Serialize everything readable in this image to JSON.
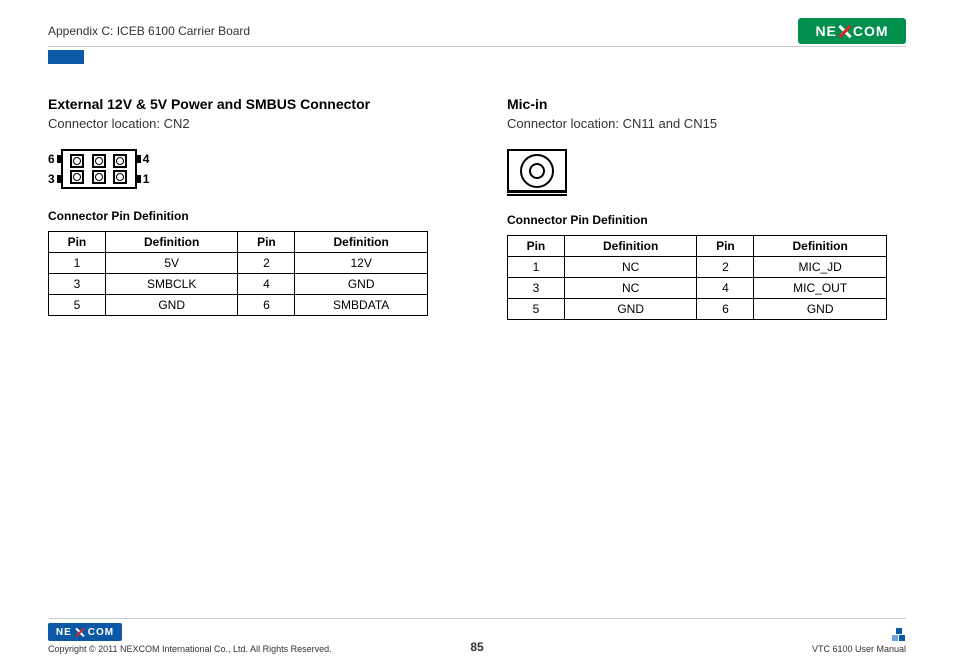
{
  "header": {
    "appendix": "Appendix C: ICEB 6100 Carrier Board",
    "brand": "NE COM"
  },
  "left": {
    "title": "External 12V & 5V Power and SMBUS Connector",
    "subtitle": "Connector location: CN2",
    "diagram_labels": {
      "tl": "6",
      "bl": "3",
      "tr": "4",
      "br": "1"
    },
    "table_title": "Connector Pin Definition",
    "headers": {
      "pin": "Pin",
      "def": "Definition"
    },
    "rows": [
      {
        "p1": "1",
        "d1": "5V",
        "p2": "2",
        "d2": "12V"
      },
      {
        "p1": "3",
        "d1": "SMBCLK",
        "p2": "4",
        "d2": "GND"
      },
      {
        "p1": "5",
        "d1": "GND",
        "p2": "6",
        "d2": "SMBDATA"
      }
    ]
  },
  "right": {
    "title": "Mic-in",
    "subtitle": "Connector location: CN11 and CN15",
    "table_title": "Connector Pin Definition",
    "headers": {
      "pin": "Pin",
      "def": "Definition"
    },
    "rows": [
      {
        "p1": "1",
        "d1": "NC",
        "p2": "2",
        "d2": "MIC_JD"
      },
      {
        "p1": "3",
        "d1": "NC",
        "p2": "4",
        "d2": "MIC_OUT"
      },
      {
        "p1": "5",
        "d1": "GND",
        "p2": "6",
        "d2": "GND"
      }
    ]
  },
  "footer": {
    "copyright": "Copyright © 2011 NEXCOM International Co., Ltd. All Rights Reserved.",
    "page": "85",
    "manual": "VTC 6100 User Manual",
    "brand": "NE COM"
  }
}
